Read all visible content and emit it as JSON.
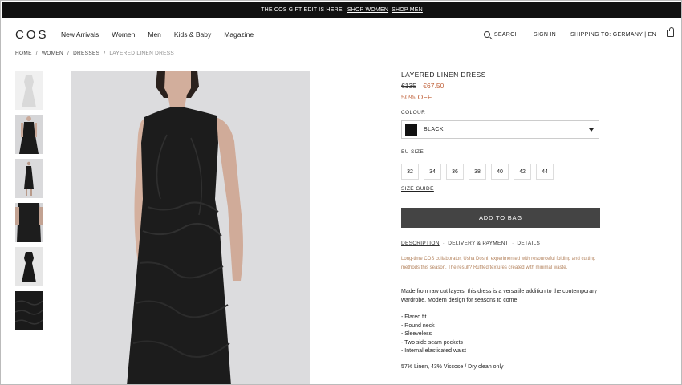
{
  "promo": {
    "text": "THE COS GIFT EDIT IS HERE!",
    "link_women": "SHOP WOMEN",
    "link_men": "SHOP MEN"
  },
  "header": {
    "logo": "COS",
    "nav": [
      "New Arrivals",
      "Women",
      "Men",
      "Kids & Baby",
      "Magazine"
    ],
    "search": "SEARCH",
    "signin": "SIGN IN",
    "shipping": "SHIPPING TO: GERMANY | EN"
  },
  "breadcrumb": {
    "home": "HOME",
    "women": "WOMEN",
    "dresses": "DRESSES",
    "current": "LAYERED LINEN DRESS",
    "separator": "/"
  },
  "product": {
    "title": "LAYERED LINEN DRESS",
    "old_price": "€135",
    "new_price": "€67.50",
    "discount": "50% OFF",
    "colour_label": "COLOUR",
    "colour_value": "BLACK",
    "size_label": "EU SIZE",
    "sizes": [
      "32",
      "34",
      "36",
      "38",
      "40",
      "42",
      "44"
    ],
    "size_guide": "SIZE GUIDE",
    "add_to_bag": "ADD TO BAG",
    "tabs": [
      "DESCRIPTION",
      "DELIVERY & PAYMENT",
      "DETAILS"
    ],
    "tab_separator": "·",
    "blurb": "Long-time COS collaborator, Usha Doshi, experimented with resourceful folding and cutting methods this season. The result? Ruffled textures created with minimal waste.",
    "description": "Made from raw cut layers, this dress is a versatile addition to the contemporary wardrobe. Modern design for seasons to come.",
    "bullets": [
      "- Flared fit",
      "- Round neck",
      "- Sleeveless",
      "- Two side seam pockets",
      "- Internal elasticated waist"
    ],
    "composition": "57% Linen, 43% Viscose / Dry clean only"
  },
  "colors": {
    "accent": "#c0623b",
    "blurb": "#b4835e",
    "button": "#444444",
    "promo_bg": "#111111"
  }
}
